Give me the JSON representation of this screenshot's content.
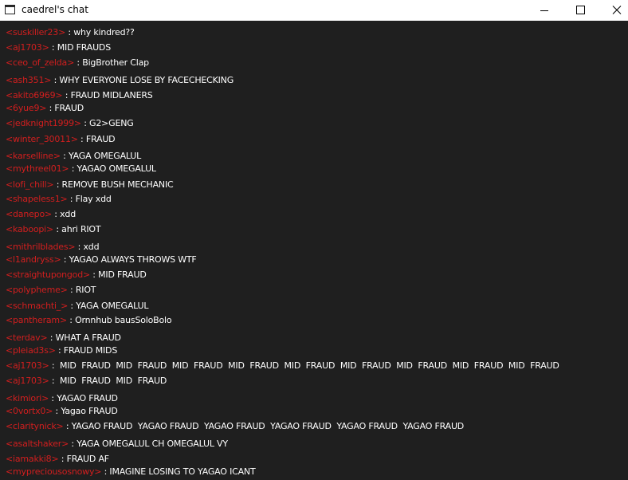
{
  "window": {
    "title": "caedrel's chat",
    "icons": {
      "app": "window-app-icon",
      "minimize": "minimize-icon",
      "maximize": "maximize-icon",
      "close": "close-icon"
    }
  },
  "colors": {
    "background": "#1f1f1f",
    "username": "#d21f1f",
    "message": "#ffffff"
  },
  "messages": [
    {
      "user": "<suskiller23>",
      "text": "why kindred??"
    },
    {
      "user": "<aj1703>",
      "text": "MID FRAUDS"
    },
    {
      "user": "<ceo_of_zelda>",
      "text": "BigBrother Clap"
    },
    {
      "user": "<ash351>",
      "text": "WHY EVERYONE LOSE BY FACECHECKING"
    },
    {
      "user": "<akito6969>",
      "text": "FRAUD MIDLANERS"
    },
    {
      "user": "<6yue9>",
      "text": "FRAUD"
    },
    {
      "user": "<jedknight1999>",
      "text": "G2>GENG"
    },
    {
      "user": "<winter_30011>",
      "text": "FRAUD"
    },
    {
      "user": "<karselline>",
      "text": "YAGA OMEGALUL"
    },
    {
      "user": "<mythreel01>",
      "text": "YAGAO OMEGALUL"
    },
    {
      "user": "<lofi_chill>",
      "text": "REMOVE BUSH MECHANIC"
    },
    {
      "user": "<shapeless1>",
      "text": "Flay xdd"
    },
    {
      "user": "<danepo>",
      "text": "xdd"
    },
    {
      "user": "<kaboopi>",
      "text": "ahri RIOT"
    },
    {
      "user": "<mithrilblades>",
      "text": "xdd"
    },
    {
      "user": "<l1andryss>",
      "text": "YAGAO ALWAYS THROWS WTF"
    },
    {
      "user": "<straightupongod>",
      "text": "MID FRAUD"
    },
    {
      "user": "<polypheme>",
      "text": "RIOT"
    },
    {
      "user": "<schmachti_>",
      "text": "YAGA OMEGALUL"
    },
    {
      "user": "<pantheram>",
      "text": "Ornnhub bausSoloBolo"
    },
    {
      "user": "<terdav>",
      "text": "WHAT A FRAUD"
    },
    {
      "user": "<pleiad3s>",
      "text": "FRAUD MIDS"
    },
    {
      "user": "<aj1703>",
      "text": " MID  FRAUD  MID  FRAUD  MID  FRAUD  MID  FRAUD  MID  FRAUD  MID  FRAUD  MID  FRAUD  MID  FRAUD  MID  FRAUD"
    },
    {
      "user": "<aj1703>",
      "text": " MID  FRAUD  MID  FRAUD"
    },
    {
      "user": "<kimiori>",
      "text": "YAGAO FRAUD"
    },
    {
      "user": "<0vortx0>",
      "text": "Yagao FRAUD"
    },
    {
      "user": "<claritynick>",
      "text": "YAGAO FRAUD  YAGAO FRAUD  YAGAO FRAUD  YAGAO FRAUD  YAGAO FRAUD  YAGAO FRAUD"
    },
    {
      "user": "<asaltshaker>",
      "text": "YAGA OMEGALUL CH OMEGALUL VY"
    },
    {
      "user": "<iamakki8>",
      "text": "FRAUD AF"
    },
    {
      "user": "<mypreciousosnowy>",
      "text": "IMAGINE LOSING TO YAGAO ICANT"
    }
  ]
}
